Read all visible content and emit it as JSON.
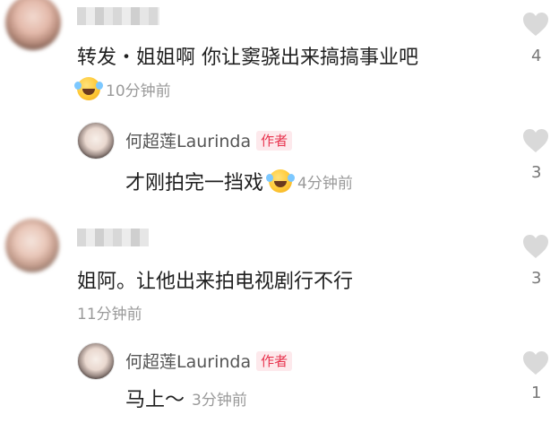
{
  "comments": [
    {
      "text": "转发・姐姐啊 你让窦骁出来搞搞事业吧",
      "emoji": "laughing-tears-emoji",
      "time": "10分钟前",
      "likes": "4",
      "reply": {
        "author": "何超莲Laurinda",
        "badge": "作者",
        "text": "才刚拍完一挡戏",
        "emoji": "laughing-tears-emoji",
        "time": "4分钟前",
        "likes": "3"
      }
    },
    {
      "text": "姐阿。让他出来拍电视剧行不行",
      "time": "11分钟前",
      "likes": "3",
      "reply": {
        "author": "何超莲Laurinda",
        "badge": "作者",
        "text": "马上～",
        "time": "3分钟前",
        "likes": "1"
      }
    }
  ],
  "colors": {
    "badge_bg": "#fde9ec",
    "badge_text": "#e8344e",
    "heart": "#d9d9d9"
  }
}
